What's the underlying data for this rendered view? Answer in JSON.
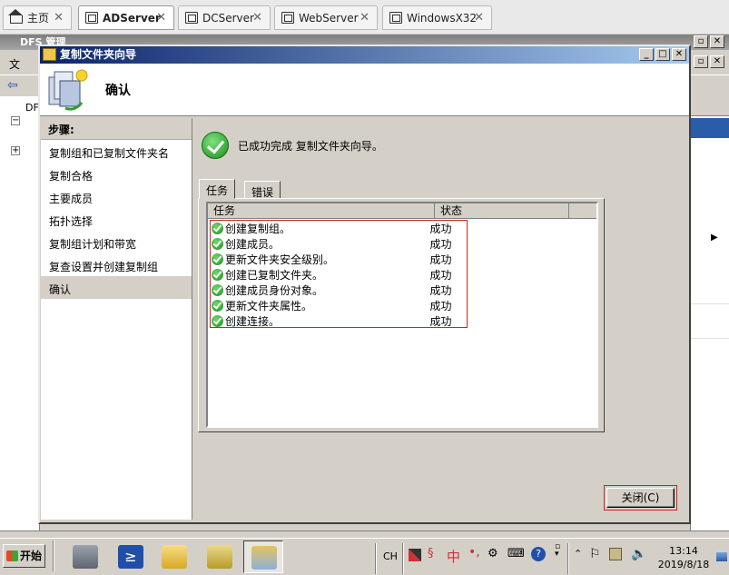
{
  "vm_tabs": [
    {
      "label": "主页",
      "icon": "home-icon",
      "active": false
    },
    {
      "label": "ADServer",
      "icon": "vm-icon",
      "active": true
    },
    {
      "label": "DCServer",
      "icon": "vm-icon",
      "active": false
    },
    {
      "label": "WebServer",
      "icon": "vm-icon",
      "active": false
    },
    {
      "label": "WindowsX32",
      "icon": "vm-icon",
      "active": false
    }
  ],
  "background_window": {
    "title": "DFS 管理",
    "menu_partial": "文",
    "tree_partial": "DF"
  },
  "dialog": {
    "title": "复制文件夹向导",
    "header_title": "确认",
    "steps_header": "步骤:",
    "steps": [
      "复制组和已复制文件夹名",
      "复制合格",
      "主要成员",
      "拓扑选择",
      "复制组计划和带宽",
      "复查设置并创建复制组",
      "确认"
    ],
    "selected_step": 6,
    "success_message": "已成功完成 复制文件夹向导。",
    "tabs": [
      "任务",
      "错误"
    ],
    "columns": [
      "任务",
      "状态"
    ],
    "tasks": [
      {
        "name": "创建复制组。",
        "status": "成功"
      },
      {
        "name": "创建成员。",
        "status": "成功"
      },
      {
        "name": "更新文件夹安全级别。",
        "status": "成功"
      },
      {
        "name": "创建已复制文件夹。",
        "status": "成功"
      },
      {
        "name": "创建成员身份对象。",
        "status": "成功"
      },
      {
        "name": "更新文件夹属性。",
        "status": "成功"
      },
      {
        "name": "创建连接。",
        "status": "成功"
      }
    ],
    "close_button": "关闭(C)"
  },
  "taskbar": {
    "start_label": "开始",
    "lang": "CH",
    "ime_text": "中",
    "time": "13:14",
    "date": "2019/8/18"
  }
}
